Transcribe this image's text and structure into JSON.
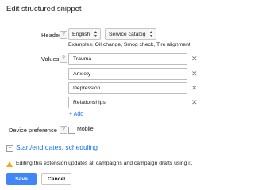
{
  "dialog": {
    "title": "Edit structured snippet"
  },
  "header": {
    "label": "Header",
    "help_icon": "?",
    "language_select": "English",
    "type_select": "Service catalog",
    "examples": "Examples: Oil change, Smog check, Tire alignment"
  },
  "values": {
    "label": "Values",
    "help_icon": "?",
    "items": [
      {
        "value": "Trauma"
      },
      {
        "value": "Anxiety"
      },
      {
        "value": "Depression"
      },
      {
        "value": "Relationships"
      }
    ],
    "remove_glyph": "✕",
    "add_label": "+ Add"
  },
  "device": {
    "label": "Device preference",
    "help_icon": "?",
    "checkbox_label": "Mobile"
  },
  "scheduling": {
    "expand_glyph": "+",
    "link_label": "Start/end dates, scheduling"
  },
  "warning": {
    "text": "Editing this extension updates all campaigns and campaign drafts using it."
  },
  "actions": {
    "save_label": "Save",
    "cancel_label": "Cancel"
  },
  "colors": {
    "accent": "#4285f4",
    "link": "#1a73e8",
    "warning": "#f5a623"
  }
}
